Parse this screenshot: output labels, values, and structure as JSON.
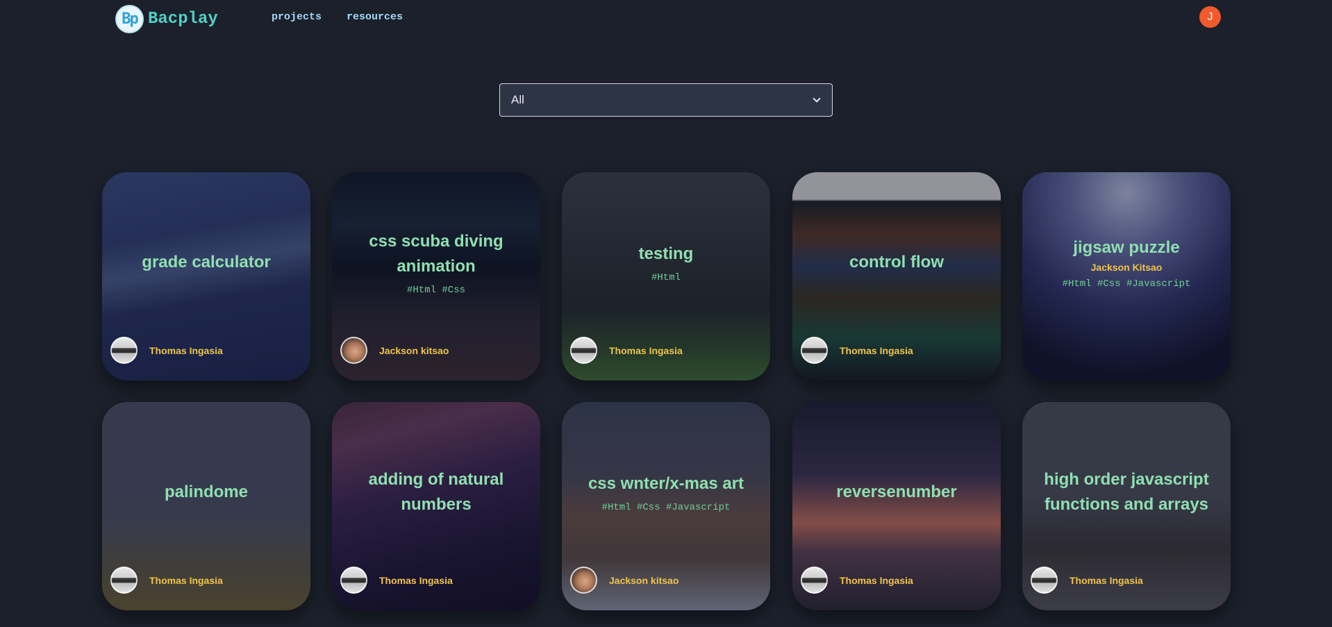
{
  "header": {
    "logo_badge": "Bp",
    "logo_text": "Bacplay",
    "nav": [
      "projects",
      "resources"
    ],
    "user_initial": "J"
  },
  "filter": {
    "value": "All"
  },
  "colors": {
    "background": "#1b202b",
    "accent_teal": "#4fd1c5",
    "title_green": "#8fe0b0",
    "author_gold": "#f0c44c",
    "avatar_orange": "#f15a2b"
  },
  "cards": [
    {
      "title": "grade calculator",
      "subtitle": "",
      "tags": "",
      "author": "Thomas Ingasia",
      "avatar": "laptop",
      "theme": "snowy-mountain"
    },
    {
      "title": "css scuba diving animation",
      "subtitle": "",
      "tags": "#Html #Css",
      "author": "Jackson kitsao",
      "avatar": "hand",
      "theme": "escalator"
    },
    {
      "title": "testing",
      "subtitle": "",
      "tags": "#Html",
      "author": "Thomas Ingasia",
      "avatar": "laptop",
      "theme": "forest"
    },
    {
      "title": "control flow",
      "subtitle": "",
      "tags": "",
      "author": "Thomas Ingasia",
      "avatar": "laptop",
      "theme": "hangers"
    },
    {
      "title": "jigsaw puzzle",
      "subtitle": "Jackson Kitsao",
      "tags": "#Html #Css #Javascript",
      "author": "",
      "avatar": "",
      "theme": "concert"
    },
    {
      "title": "palindome",
      "subtitle": "",
      "tags": "",
      "author": "Thomas Ingasia",
      "avatar": "laptop",
      "theme": "foggy-field"
    },
    {
      "title": "adding of natural numbers",
      "subtitle": "",
      "tags": "",
      "author": "Thomas Ingasia",
      "avatar": "laptop",
      "theme": "purple-sky"
    },
    {
      "title": "css wnter/x-mas art",
      "subtitle": "",
      "tags": "#Html #Css #Javascript",
      "author": "Jackson kitsao",
      "avatar": "hand",
      "theme": "walrus"
    },
    {
      "title": "reversenumber",
      "subtitle": "",
      "tags": "",
      "author": "Thomas Ingasia",
      "avatar": "laptop",
      "theme": "rail-sunset"
    },
    {
      "title": "high order javascript functions and arrays",
      "subtitle": "",
      "tags": "",
      "author": "Thomas Ingasia",
      "avatar": "laptop",
      "theme": "person-sea"
    }
  ]
}
